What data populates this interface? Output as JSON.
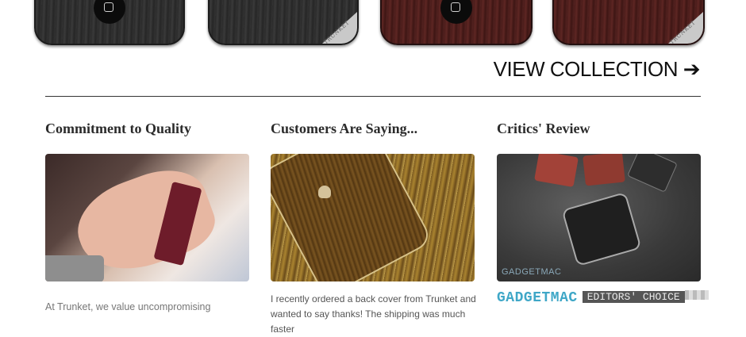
{
  "phones": [
    {
      "finish": "dark wood",
      "home_icon": "home-button-icon",
      "corner": false
    },
    {
      "finish": "dark wood",
      "home_icon": "",
      "corner": true
    },
    {
      "finish": "red wood",
      "home_icon": "home-button-icon",
      "corner": false
    },
    {
      "finish": "red wood",
      "home_icon": "",
      "corner": true
    }
  ],
  "corner_label": "TRUNKET",
  "view_collection": {
    "label": "VIEW COLLECTION ➔",
    "icon": "arrow-right-icon"
  },
  "columns": [
    {
      "title": "Commitment to Quality",
      "text": "At Trunket, we value uncompromising"
    },
    {
      "title": "Customers Are Saying...",
      "text": "I recently ordered a back cover from Trunket and wanted to say thanks! The shipping was much faster"
    },
    {
      "title": "Critics' Review",
      "text": ""
    }
  ],
  "critics": {
    "watermark": "GADGETMAC",
    "brand": "GADGETMAC",
    "badge": "EDITORS' CHOICE"
  }
}
